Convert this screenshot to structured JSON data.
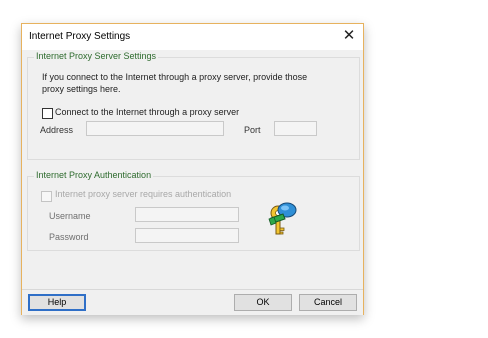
{
  "window": {
    "title": "Internet Proxy Settings",
    "close_glyph": "✕"
  },
  "proxy_settings": {
    "group_label": "Internet Proxy Server Settings",
    "info_text": "If you connect to the Internet through a proxy server, provide those proxy settings here.",
    "connect_checkbox": {
      "label": "Connect to the Internet through a proxy server",
      "checked": false
    },
    "address_label": "Address",
    "address_value": "",
    "port_label": "Port",
    "port_value": ""
  },
  "proxy_auth": {
    "group_label": "Internet Proxy Authentication",
    "auth_checkbox": {
      "label": "Internet proxy server requires authentication",
      "checked": false,
      "enabled": false
    },
    "username_label": "Username",
    "username_value": "",
    "password_label": "Password",
    "password_value": "",
    "icon": "keys-icon"
  },
  "buttons": {
    "help": "Help",
    "ok": "OK",
    "cancel": "Cancel"
  },
  "colors": {
    "group_heading": "#2e6b2e",
    "dialog_border": "#e7b25e",
    "default_button_border": "#2f6fc7"
  }
}
